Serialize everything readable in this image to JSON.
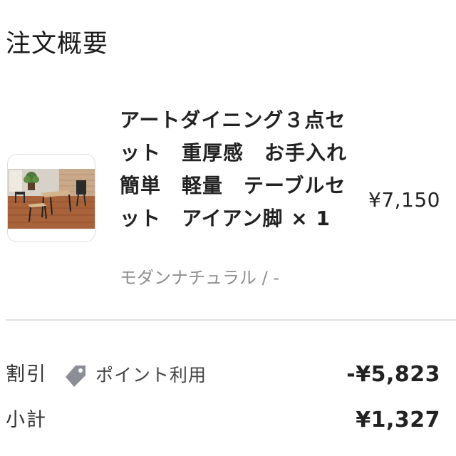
{
  "order_summary": {
    "title": "注文概要"
  },
  "item": {
    "name": "アートダイニング３点セット　重厚感　お手入れ簡単　軽量　テーブルセット　アイアン脚 × 1",
    "variant": "モダンナチュラル / -",
    "price": "¥7,150",
    "thumbnail_alt": "product-thumbnail"
  },
  "summary": {
    "discount": {
      "label": "割引",
      "coupon_icon": "tag-icon",
      "coupon_label": "ポイント利用",
      "value": "-¥5,823"
    },
    "subtotal": {
      "label": "小計",
      "value": "¥1,327"
    }
  },
  "colors": {
    "text_primary": "#222222",
    "text_secondary": "#8e8e8e",
    "divider": "#e2e2e2",
    "tag_icon": "#8a8f95"
  }
}
